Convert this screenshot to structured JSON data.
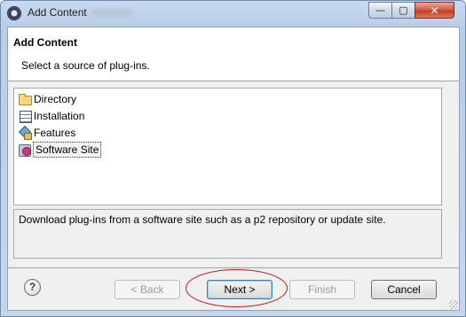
{
  "window": {
    "title": "Add Content",
    "controls": {
      "minimize": "—",
      "maximize": "▢",
      "close": "✕"
    }
  },
  "header": {
    "title": "Add Content",
    "message": "Select a source of plug-ins."
  },
  "sources": [
    {
      "label": "Directory",
      "icon": "folder-icon",
      "selected": false
    },
    {
      "label": "Installation",
      "icon": "installation-icon",
      "selected": false
    },
    {
      "label": "Features",
      "icon": "features-icon",
      "selected": false
    },
    {
      "label": "Software Site",
      "icon": "software-site-icon",
      "selected": true
    }
  ],
  "description": "Download plug-ins from a software site such as a p2 repository or update site.",
  "buttons": {
    "help": "?",
    "back": "< Back",
    "next": "Next >",
    "finish": "Finish",
    "cancel": "Cancel"
  },
  "colors": {
    "annotation": "#c0161c",
    "titlebar": "#c9daee"
  }
}
